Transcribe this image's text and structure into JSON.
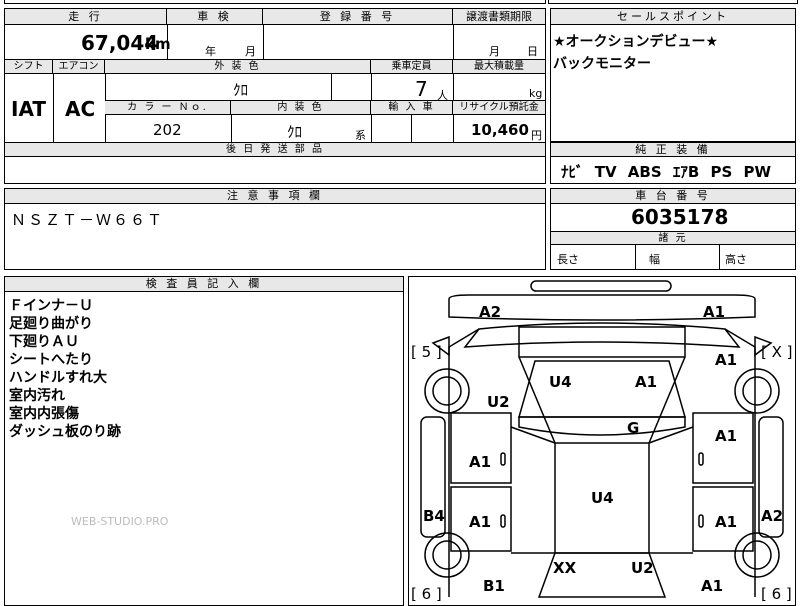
{
  "top": {
    "mileage_label": "走 行",
    "mileage_value": "67,044",
    "mileage_unit": "km",
    "inspection_label": "車 検",
    "inspection_year": "年",
    "inspection_month": "月",
    "registration_label": "登 録 番 号",
    "transfer_label": "譲渡書類期限",
    "transfer_month": "月",
    "transfer_day": "日"
  },
  "row2": {
    "shift_label": "シフト",
    "shift_value": "IAT",
    "ac_label": "エアコン",
    "ac_value": "AC",
    "exterior_label": "外 装 色",
    "exterior_value": "ｸﾛ",
    "capacity_label": "乗車定員",
    "capacity_value": "7",
    "capacity_unit": "人",
    "payload_label": "最大積載量",
    "payload_unit": "kg",
    "color_no_label": "カ ラ ー Ｎｏ.",
    "color_no_value": "202",
    "interior_label": "内 装 色",
    "interior_value": "ｸﾛ",
    "interior_unit": "系",
    "import_label": "輸 入 車",
    "recycle_label": "リサイクル預託金",
    "recycle_value": "10,460",
    "recycle_unit": "円",
    "later_parts_label": "後 日 発 送 部 品"
  },
  "sales": {
    "label": "セールスポイント",
    "lines": [
      "★オークションデビュー★",
      "バックモニター"
    ]
  },
  "equipment": {
    "label": "純 正 装 備",
    "value": "ﾅﾋﾞ TV ABS ｴｱB PS PW"
  },
  "notes": {
    "label": "注 意 事 項 欄",
    "value": "ＮＳＺＴ－Ｗ６６Ｔ"
  },
  "chassis": {
    "label": "車 台 番 号",
    "value": "6035178",
    "dims_label": "諸 元",
    "length": "長さ",
    "width": "幅",
    "height": "高さ"
  },
  "inspector": {
    "label": "検 査 員 記 入 欄",
    "lines": [
      "Ｆインナ－Ｕ",
      "足廻り曲がり",
      "下廻りＡＵ",
      "シートへたり",
      "ハンドルすれ大",
      "室内汚れ",
      "室内内張傷",
      "ダッシュ板のり跡"
    ],
    "watermark": "WEB-STUDIO.PRO"
  },
  "diagram": {
    "marks": {
      "front_left": "A2",
      "front_right": "A1",
      "left_count": "[ 5 ]",
      "right_count": "[ X ]",
      "hood_left": "U4",
      "hood_right": "A1",
      "right_fender": "A1",
      "left_pillar": "U2",
      "windshield": "G",
      "left_front_door": "A1",
      "right_front_door": "A1",
      "roof": "U4",
      "left_sill": "B4",
      "left_rear_door": "A1",
      "right_rear_door": "A1",
      "right_quarter": "A2",
      "rear_glass_left": "XX",
      "rear_glass_right": "U2",
      "left_rear": "B1",
      "right_rear": "A1",
      "left_bottom_count": "[ 6 ]",
      "right_bottom_count": "[ 6 ]"
    }
  }
}
